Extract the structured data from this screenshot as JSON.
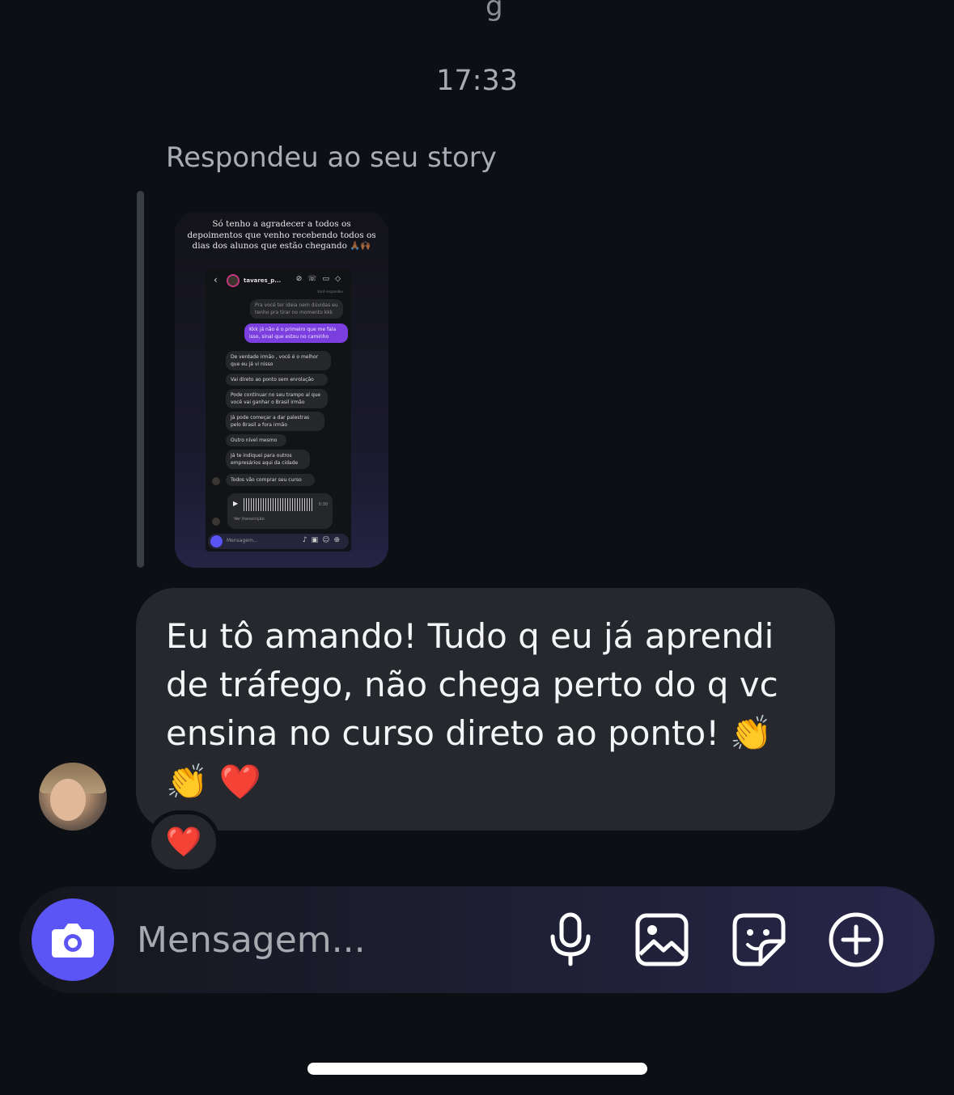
{
  "status": {
    "top_fragment": "g"
  },
  "chat": {
    "timestamp": "17:33",
    "reply_label": "Respondeu ao seu story",
    "story": {
      "caption": "Só tenho a agradecer a todos os depoimentos que venho recebendo todos os dias dos alunos que estão chegando 🙏🏾🙌🏾",
      "screenshot": {
        "username": "tavares_p...",
        "subheader": "Você respondeu",
        "messages": [
          {
            "text": "Pra você ter ideia nem dúvidas eu tenho pra tirar no momento kkk",
            "type": "sent-faded"
          },
          {
            "text": "Kkk já não é o primeiro que me fala isso, sinal que estou no caminho",
            "type": "sent"
          },
          {
            "text": "De verdade irmão , você é o melhor que eu já vi nisso",
            "type": "received"
          },
          {
            "text": "Vai direto ao ponto sem enrolação",
            "type": "received"
          },
          {
            "text": "Pode continuar no seu trampo aí que você vai ganhar o Brasil irmão",
            "type": "received"
          },
          {
            "text": "Já pode começar a dar palestras pelo Brasil a fora irmão",
            "type": "received"
          },
          {
            "text": "Outro nível mesmo",
            "type": "received"
          },
          {
            "text": "Já te indiquei para outros empresários aqui da cidade",
            "type": "received"
          },
          {
            "text": "Todos vão comprar seu curso",
            "type": "received"
          }
        ],
        "audio_duration": "0:30",
        "audio_transcript_label": "Ver transcrição",
        "composer_placeholder": "Mensagem..."
      }
    },
    "message": {
      "text": "Eu tô amando! Tudo q eu já aprendi\nde tráfego, não chega perto do q vc\nensina no curso direto ao ponto! 👏\n👏 ❤️"
    },
    "reaction": "❤️"
  },
  "composer": {
    "placeholder": "Mensagem..."
  },
  "icons": {
    "camera": "camera-icon",
    "microphone": "microphone-icon",
    "gallery": "gallery-icon",
    "sticker": "sticker-icon",
    "add": "plus-circle-icon"
  },
  "colors": {
    "background": "#0c0f14",
    "bubble": "#26282d",
    "accent": "#5b55f5",
    "text_secondary": "#a8adb5"
  }
}
